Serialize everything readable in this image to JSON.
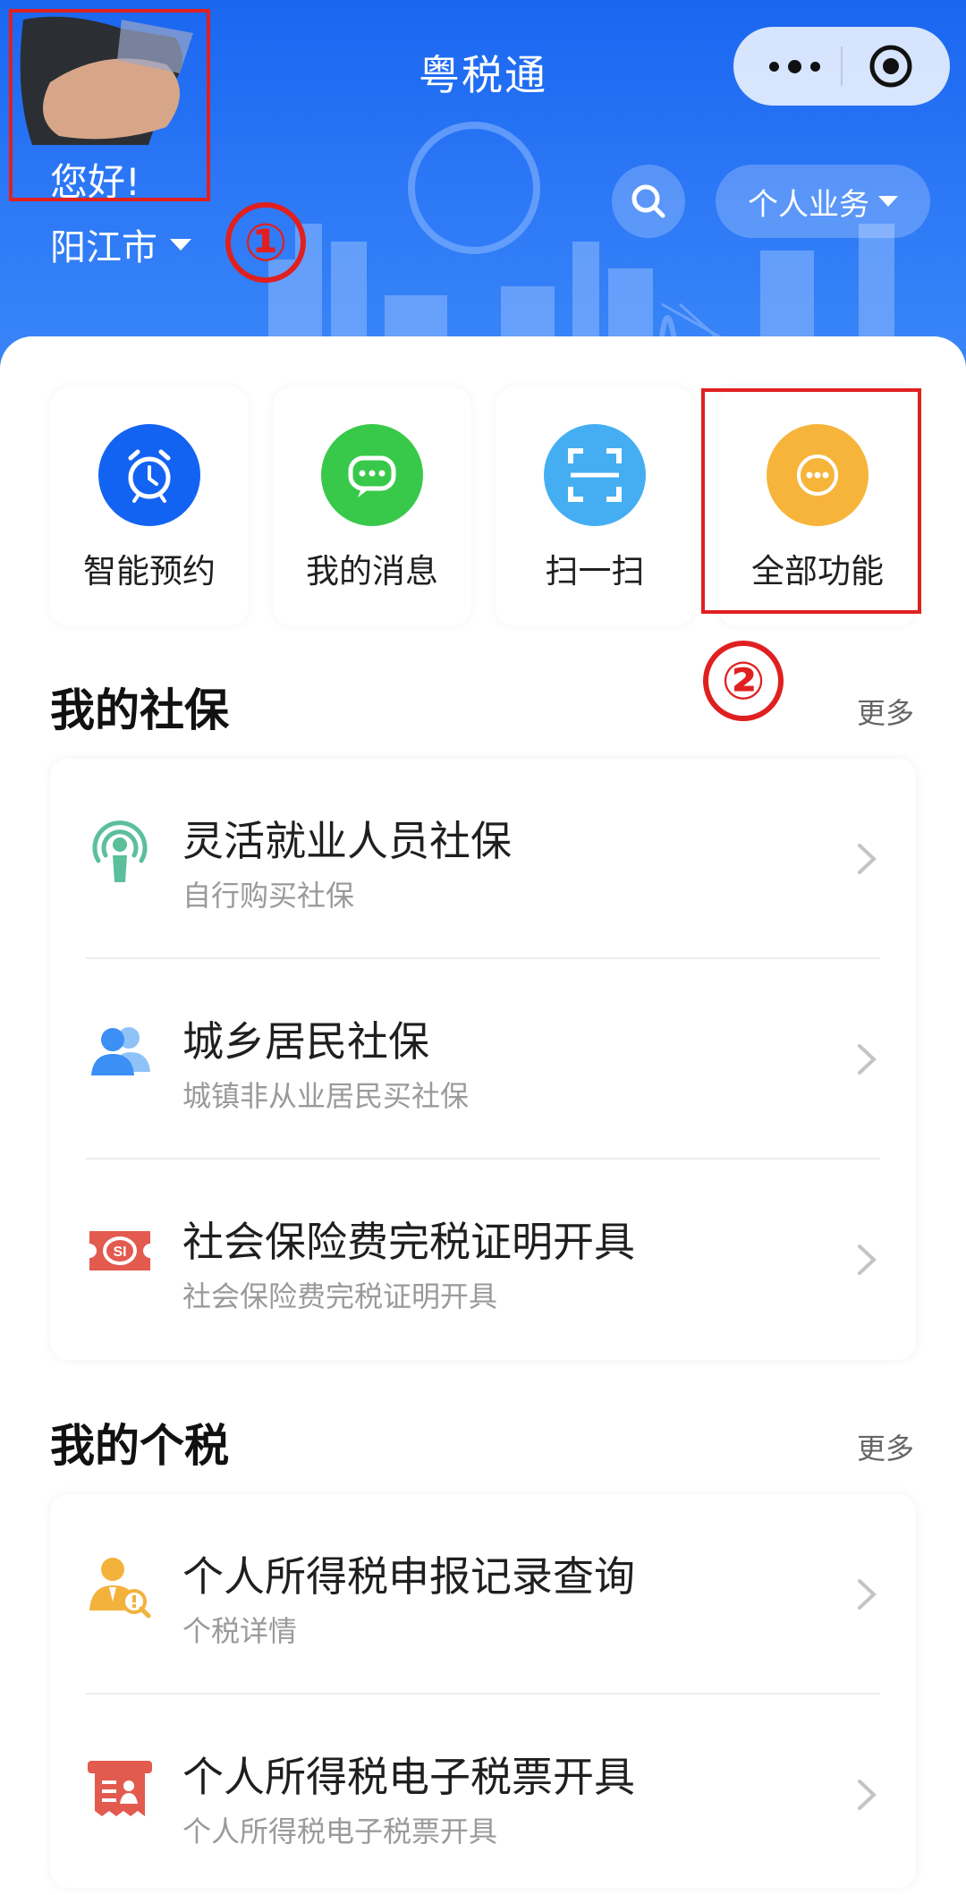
{
  "header": {
    "title": "粤税通",
    "greeting": "您好!",
    "city": "阳江市",
    "business_label": "个人业务",
    "annotation_1": "①"
  },
  "quick_actions": [
    {
      "label": "智能预约",
      "icon": "alarm-clock-icon",
      "color": "#1363f2"
    },
    {
      "label": "我的消息",
      "icon": "chat-bubble-icon",
      "color": "#38c94a"
    },
    {
      "label": "扫一扫",
      "icon": "scan-icon",
      "color": "#45aef2"
    },
    {
      "label": "全部功能",
      "icon": "more-dots-icon",
      "color": "#f6b53a"
    }
  ],
  "annotation_2": "②",
  "social": {
    "title": "我的社保",
    "more": "更多",
    "items": [
      {
        "title": "灵活就业人员社保",
        "subtitle": "自行购买社保",
        "icon": "broadcast-person-icon"
      },
      {
        "title": "城乡居民社保",
        "subtitle": "城镇非从业居民买社保",
        "icon": "users-icon"
      },
      {
        "title": "社会保险费完税证明开具",
        "subtitle": "社会保险费完税证明开具",
        "icon": "si-ticket-icon"
      }
    ]
  },
  "tax": {
    "title": "我的个税",
    "more": "更多",
    "items": [
      {
        "title": "个人所得税申报记录查询",
        "subtitle": "个税详情",
        "icon": "user-search-icon"
      },
      {
        "title": "个人所得税电子税票开具",
        "subtitle": "个人所得税电子税票开具",
        "icon": "receipt-icon"
      }
    ]
  },
  "colors": {
    "header_blue": "#1a66f0",
    "annotation_red": "#e02020",
    "icon_green": "#5bbf9b",
    "icon_blue": "#3b8ff5",
    "icon_red": "#e35a4f",
    "icon_orange": "#f3b23c"
  }
}
